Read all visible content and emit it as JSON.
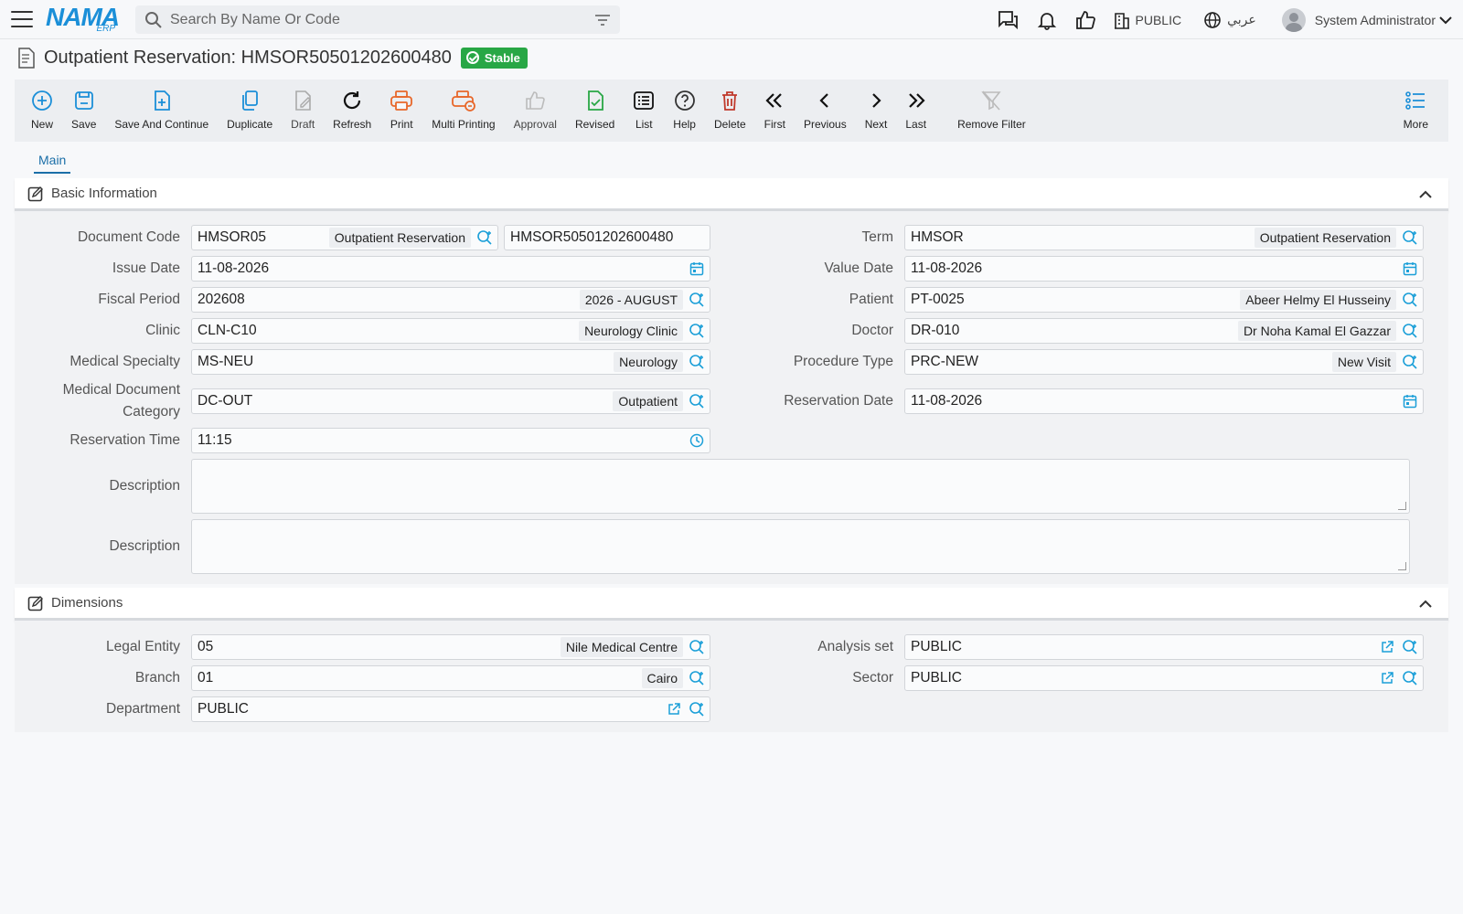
{
  "header": {
    "logo_text": "NAMA",
    "logo_sub": "ERP",
    "search_placeholder": "Search By Name Or Code",
    "branch": "PUBLIC",
    "language": "عربي",
    "user": "System Administrator"
  },
  "page": {
    "title": "Outpatient Reservation: HMSOR50501202600480",
    "status": "Stable"
  },
  "toolbar": [
    {
      "label": "New",
      "icon": "plus-circle-icon"
    },
    {
      "label": "Save",
      "icon": "save-icon"
    },
    {
      "label": "Save And Continue",
      "icon": "file-add-icon"
    },
    {
      "label": "Duplicate",
      "icon": "duplicate-icon"
    },
    {
      "label": "Draft",
      "icon": "draft-icon"
    },
    {
      "label": "Refresh",
      "icon": "refresh-icon"
    },
    {
      "label": "Print",
      "icon": "print-icon"
    },
    {
      "label": "Multi Printing",
      "icon": "multi-print-icon"
    },
    {
      "label": "Approval",
      "icon": "thumb-up-icon"
    },
    {
      "label": "Revised",
      "icon": "revised-icon"
    },
    {
      "label": "List",
      "icon": "list-icon"
    },
    {
      "label": "Help",
      "icon": "help-icon"
    },
    {
      "label": "Delete",
      "icon": "trash-icon"
    },
    {
      "label": "First",
      "icon": "double-chevron-left-icon"
    },
    {
      "label": "Previous",
      "icon": "chevron-left-icon"
    },
    {
      "label": "Next",
      "icon": "chevron-right-icon"
    },
    {
      "label": "Last",
      "icon": "double-chevron-right-icon"
    },
    {
      "label": "Remove Filter",
      "icon": "filter-off-icon"
    },
    {
      "label": "More",
      "icon": "more-list-icon"
    }
  ],
  "tabs": [
    {
      "label": "Main"
    }
  ],
  "basic": {
    "title": "Basic Information",
    "document_code": {
      "label": "Document Code",
      "value": "HMSOR05",
      "desc": "Outpatient Reservation",
      "code": "HMSOR50501202600480"
    },
    "term": {
      "label": "Term",
      "value": "HMSOR",
      "desc": "Outpatient Reservation"
    },
    "issue_date": {
      "label": "Issue Date",
      "value": "11-08-2026"
    },
    "value_date": {
      "label": "Value Date",
      "value": "11-08-2026"
    },
    "fiscal_period": {
      "label": "Fiscal Period",
      "value": "202608",
      "desc": "2026 - AUGUST"
    },
    "patient": {
      "label": "Patient",
      "value": "PT-0025",
      "desc": "Abeer Helmy El Husseiny"
    },
    "clinic": {
      "label": "Clinic",
      "value": "CLN-C10",
      "desc": "Neurology Clinic"
    },
    "doctor": {
      "label": "Doctor",
      "value": "DR-010",
      "desc": "Dr Noha Kamal El Gazzar"
    },
    "specialty": {
      "label": "Medical Specialty",
      "value": "MS-NEU",
      "desc": "Neurology"
    },
    "procedure": {
      "label": "Procedure Type",
      "value": "PRC-NEW",
      "desc": "New Visit"
    },
    "doc_category": {
      "label_1": "Medical Document",
      "label_2": "Category",
      "value": "DC-OUT",
      "desc": "Outpatient"
    },
    "reservation_date": {
      "label": "Reservation Date",
      "value": "11-08-2026"
    },
    "reservation_time": {
      "label": "Reservation Time",
      "value": "11:15"
    },
    "description1": {
      "label": "Description",
      "value": ""
    },
    "description2": {
      "label": "Description",
      "value": ""
    }
  },
  "dimensions": {
    "title": "Dimensions",
    "legal_entity": {
      "label": "Legal Entity",
      "value": "05",
      "desc": "Nile Medical Centre"
    },
    "analysis_set": {
      "label": "Analysis set",
      "value": "PUBLIC"
    },
    "branch": {
      "label": "Branch",
      "value": "01",
      "desc": "Cairo"
    },
    "sector": {
      "label": "Sector",
      "value": "PUBLIC"
    },
    "department": {
      "label": "Department",
      "value": "PUBLIC"
    }
  },
  "colors": {
    "accent": "#1b8fd8",
    "success": "#28a745",
    "danger": "#c0392b",
    "print": "#e8672a"
  }
}
